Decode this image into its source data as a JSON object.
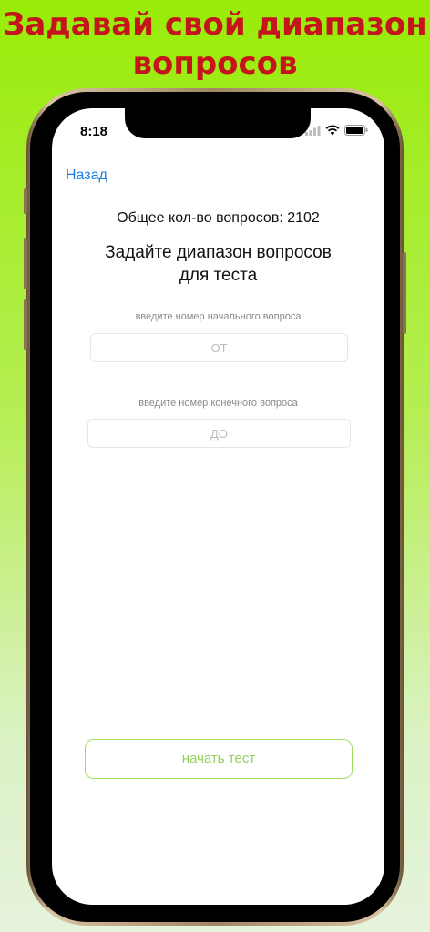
{
  "promo": {
    "line1": "Задавай свой диапазон",
    "line2": "вопросов"
  },
  "status_bar": {
    "time": "8:18"
  },
  "nav": {
    "back_label": "Назад"
  },
  "main": {
    "total_text": "Общее кол-во вопросов: 2102",
    "heading_line1": "Задайте диапазон вопросов",
    "heading_line2": "для теста",
    "start_hint": "введите номер начального вопроса",
    "start_placeholder": "ОТ",
    "end_hint": "введите номер конечного вопроса",
    "end_placeholder": "ДО",
    "start_button": "начать тест"
  },
  "colors": {
    "background_top": "#98ec08",
    "promo_text": "#c5141b",
    "link": "#1d7fe3",
    "button_accent": "#92d05a"
  }
}
